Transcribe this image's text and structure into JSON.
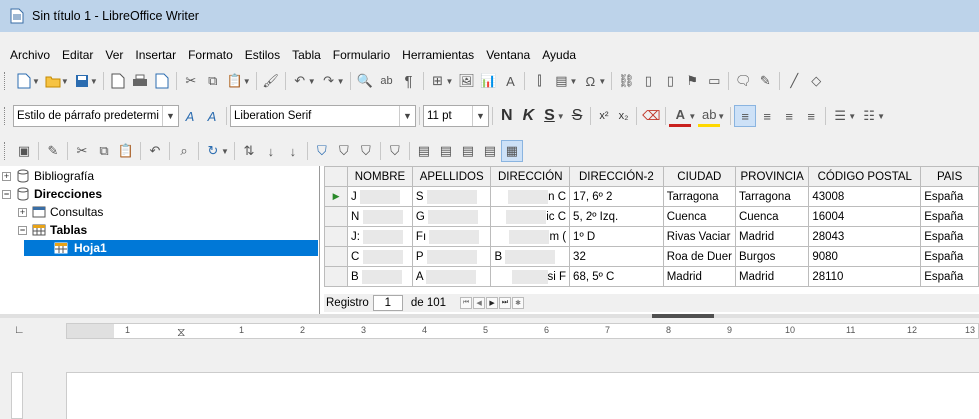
{
  "window": {
    "title": "Sin título 1 - LibreOffice Writer"
  },
  "menu": [
    "Archivo",
    "Editar",
    "Ver",
    "Insertar",
    "Formato",
    "Estilos",
    "Tabla",
    "Formulario",
    "Herramientas",
    "Ventana",
    "Ayuda"
  ],
  "format_bar": {
    "paragraph_style": "Estilo de párrafo predetermi",
    "font_name": "Liberation Serif",
    "font_size": "11 pt",
    "bold": "N",
    "italic": "K",
    "underline": "S",
    "strike": "S",
    "superscript": "x²",
    "subscript": "x₂"
  },
  "tree": {
    "items": [
      {
        "label": "Bibliografía",
        "expander": "+"
      },
      {
        "label": "Direcciones",
        "expander": "−"
      },
      {
        "label": "Consultas",
        "expander": "+"
      },
      {
        "label": "Tablas",
        "expander": "−"
      },
      {
        "label": "Hoja1"
      }
    ]
  },
  "table": {
    "columns": [
      "NOMBRE",
      "APELLIDOS",
      "DIRECCIÓN",
      "DIRECCIÓN-2",
      "CIUDAD",
      "PROVINCIA",
      "CÓDIGO POSTAL",
      "PAIS"
    ],
    "rows": [
      {
        "c0": "J",
        "c1": "S",
        "c2": "n C",
        "c3": "17, 6º 2",
        "c4": "Tarragona",
        "c5": "Tarragona",
        "c6": "43008",
        "c7": "España"
      },
      {
        "c0": "N",
        "c1": "G",
        "c2": "ic C",
        "c3": "5, 2º Izq.",
        "c4": "Cuenca",
        "c5": "Cuenca",
        "c6": "16004",
        "c7": "España"
      },
      {
        "c0": "J:",
        "c1": "Fı",
        "c2": "m (",
        "c3": "1º D",
        "c4": "Rivas Vaciar",
        "c5": "Madrid",
        "c6": "28043",
        "c7": "España"
      },
      {
        "c0": "C",
        "c1": "P",
        "c2": "B",
        "c3": "32",
        "c4": "Roa de Duer",
        "c5": "Burgos",
        "c6": "9080",
        "c7": "España"
      },
      {
        "c0": "B",
        "c1": "A",
        "c2": "si F",
        "c3": "68, 5º C",
        "c4": "Madrid",
        "c5": "Madrid",
        "c6": "28110",
        "c7": "España"
      }
    ]
  },
  "record_nav": {
    "label": "Registro",
    "current": "1",
    "total": "de 101"
  },
  "ruler": {
    "numbers": [
      "1",
      "1",
      "2",
      "3",
      "4",
      "5",
      "6",
      "7",
      "8",
      "9",
      "10",
      "11",
      "12",
      "13"
    ]
  }
}
